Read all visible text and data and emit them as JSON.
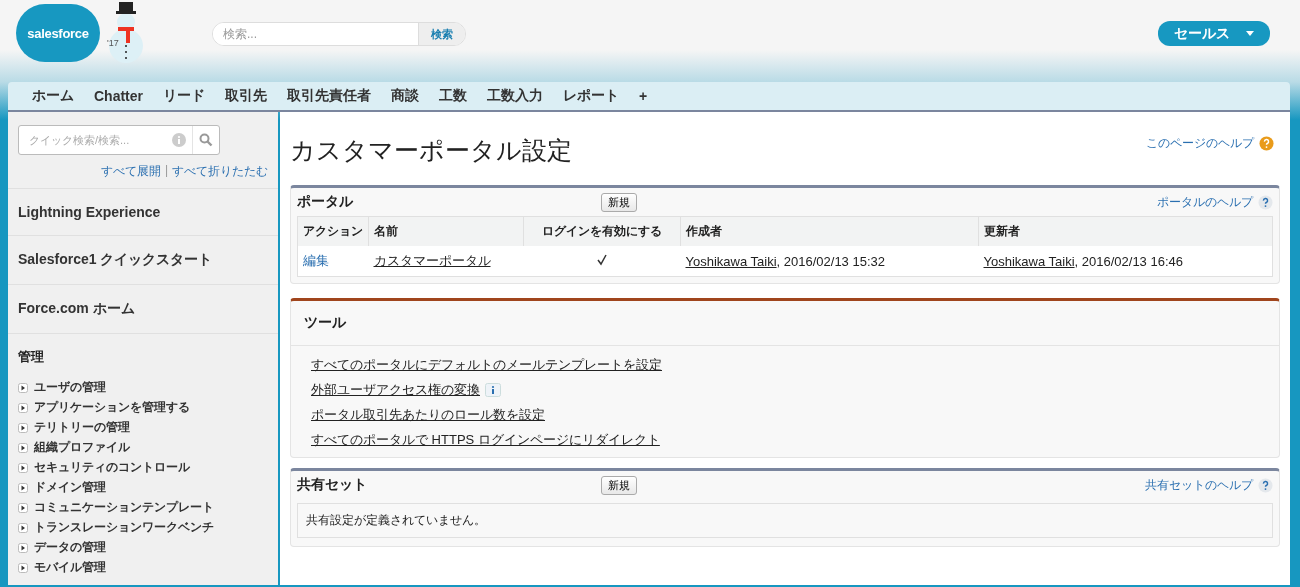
{
  "header": {
    "logo": "salesforce",
    "snowman_label": "'17",
    "search": {
      "placeholder": "検索...",
      "button": "検索"
    },
    "app_menu": "セールス"
  },
  "tabs": [
    {
      "label": "ホーム",
      "selected": false
    },
    {
      "label": "Chatter",
      "selected": false
    },
    {
      "label": "リード",
      "selected": false
    },
    {
      "label": "取引先",
      "selected": false
    },
    {
      "label": "取引先責任者",
      "selected": false
    },
    {
      "label": "商談",
      "selected": false
    },
    {
      "label": "工数",
      "selected": false
    },
    {
      "label": "工数入力",
      "selected": false
    },
    {
      "label": "レポート",
      "selected": false
    },
    {
      "label": "+",
      "selected": false
    }
  ],
  "sidebar": {
    "search": {
      "placeholder": "クイック検索/検索..."
    },
    "expand_all": "すべて展開",
    "separator": "|",
    "collapse_all": "すべて折りたたむ",
    "sections": [
      {
        "label": "Lightning Experience"
      },
      {
        "label": "Salesforce1 クイックスタート"
      },
      {
        "label": "Force.com ホーム"
      }
    ],
    "admin": {
      "title": "管理",
      "items": [
        {
          "label": "ユーザの管理",
          "expanded": false
        },
        {
          "label": "アプリケーションを管理する",
          "expanded": false
        },
        {
          "label": "テリトリーの管理",
          "expanded": false
        },
        {
          "label": "組織プロファイル",
          "expanded": false
        },
        {
          "label": "セキュリティのコントロール",
          "expanded": false
        },
        {
          "label": "ドメイン管理",
          "expanded": false
        },
        {
          "label": "コミュニケーションテンプレート",
          "expanded": false
        },
        {
          "label": "トランスレーションワークベンチ",
          "expanded": false
        },
        {
          "label": "データの管理",
          "expanded": false
        },
        {
          "label": "モバイル管理",
          "expanded": false
        }
      ]
    }
  },
  "page": {
    "title": "カスタマーポータル設定",
    "help": "このページのヘルプ"
  },
  "portal": {
    "title": "ポータル",
    "new_button": "新規",
    "help": "ポータルのヘルプ",
    "columns": [
      "アクション",
      "名前",
      "ログインを有効にする",
      "作成者",
      "更新者"
    ],
    "rows": [
      {
        "action": "編集",
        "name": "カスタマーポータル",
        "login_enabled": true,
        "created_by": "Yoshikawa Taiki",
        "created_at": ", 2016/02/13 15:32",
        "updated_by": "Yoshikawa Taiki",
        "updated_at": ", 2016/02/13 16:46"
      }
    ]
  },
  "tools": {
    "title": "ツール",
    "links": [
      {
        "label": "すべてのポータルにデフォルトのメールテンプレートを設定",
        "info": false
      },
      {
        "label": "外部ユーザアクセス権の変換",
        "info": true
      },
      {
        "label": "ポータル取引先あたりのロール数を設定",
        "info": false
      },
      {
        "label": "すべてのポータルで HTTPS ログインページにリダイレクト",
        "info": false
      }
    ]
  },
  "sharing_sets": {
    "title": "共有セット",
    "new_button": "新規",
    "help": "共有セットのヘルプ",
    "empty": "共有設定が定義されていません。"
  }
}
